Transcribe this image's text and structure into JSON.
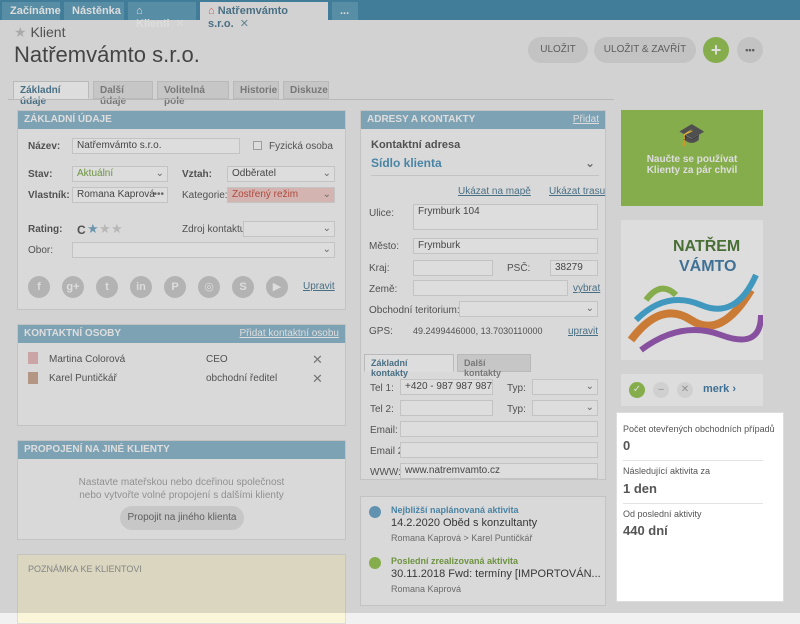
{
  "tabs": [
    {
      "label": "Začínáme"
    },
    {
      "label": "Nástěnka"
    },
    {
      "label": "Klienti"
    },
    {
      "label": "Natřemvámto s.r.o."
    },
    {
      "label": "..."
    }
  ],
  "header": {
    "kind": "Klient",
    "title": "Natřemvámto s.r.o.",
    "save": "ULOŽIT",
    "save_close": "ULOŽIT & ZAVŘÍT",
    "add": "+",
    "more": "•••"
  },
  "subtabs": [
    "Základní údaje",
    "Další údaje",
    "Volitelná pole",
    "Historie",
    "Diskuze"
  ],
  "basic": {
    "title": "ZÁKLADNÍ ÚDAJE",
    "name_label": "Název:",
    "name_value": "Natřemvámto s.r.o.",
    "person_label": "Fyzická osoba",
    "state_label": "Stav:",
    "state_value": "Aktuální",
    "relation_label": "Vztah:",
    "relation_value": "Odběratel",
    "owner_label": "Vlastník:",
    "owner_value": "Romana Kaprová",
    "category_label": "Kategorie:",
    "category_value": "Zostřený režim",
    "rating_label": "Rating:",
    "rating_value": "C",
    "source_label": "Zdroj kontaktu:",
    "field_label": "Obor:",
    "edit": "Upravit"
  },
  "contacts": {
    "title": "KONTAKTNÍ OSOBY",
    "add": "Přidat kontaktní osobu",
    "rows": [
      {
        "name": "Martina Colorová",
        "role": "CEO"
      },
      {
        "name": "Karel Puntičkář",
        "role": "obchodní ředitel"
      }
    ]
  },
  "links": {
    "title": "PROPOJENÍ NA JINÉ KLIENTY",
    "text1": "Nastavte mateřskou nebo dceřinou společnost",
    "text2": "nebo vytvořte volné propojení s dalšími klienty",
    "button": "Propojit na jiného klienta"
  },
  "note": {
    "title": "POZNÁMKA KE KLIENTOVI"
  },
  "address": {
    "title": "ADRESY A KONTAKTY",
    "add": "Přidat",
    "contact_address": "Kontaktní adresa",
    "seat": "Sídlo klienta",
    "show_map": "Ukázat na mapě",
    "show_route": "Ukázat trasu",
    "street_label": "Ulice:",
    "street_value": "Frymburk 104",
    "city_label": "Město:",
    "city_value": "Frymburk",
    "region_label": "Kraj:",
    "zip_label": "PSČ:",
    "zip_value": "38279",
    "country_label": "Země:",
    "country_link": "vybrat",
    "territory_label": "Obchodní teritorium:",
    "gps_label": "GPS:",
    "gps_value": "49.2499446000, 13.7030110000",
    "gps_link": "upravit",
    "tab_basic": "Základní kontakty",
    "tab_more": "Další kontakty",
    "tel1_label": "Tel 1:",
    "tel1_value": "+420 - 987 987 987",
    "type_label": "Typ:",
    "tel2_label": "Tel 2:",
    "type2_label": "Typ:",
    "email_label": "Email:",
    "email2_label": "Email 2:",
    "www_label": "WWW:",
    "www_value": "www.natremvamto.cz"
  },
  "activities": [
    {
      "heading": "Nejbližší naplánovaná aktivita",
      "line": "14.2.2020  Oběd s konzultanty",
      "people": "Romana Kaprová > Karel Puntičkář"
    },
    {
      "heading": "Poslední zrealizovaná aktivita",
      "line": "30.11.2018  Fwd: termíny [IMPORTOVÁN...",
      "people": "Romana Kaprová"
    }
  ],
  "promo": {
    "text1": "Naučte se používat",
    "text2": "Klienty za pár chvil"
  },
  "logo": {
    "line1": "NATŘEM",
    "line2": "VÁMTO"
  },
  "merk": {
    "label": "merk ›"
  },
  "stats": [
    {
      "label": "Počet otevřených obchodních případů",
      "value": "0"
    },
    {
      "label": "Následující aktivita za",
      "value": "1 den"
    },
    {
      "label": "Od poslední aktivity",
      "value": "440 dní"
    }
  ]
}
